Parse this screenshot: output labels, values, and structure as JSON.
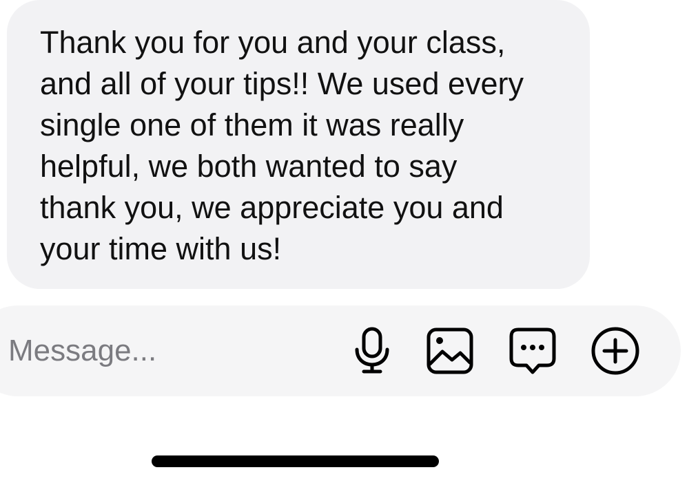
{
  "conversation": {
    "messages": [
      {
        "direction": "incoming",
        "text": "Thank you for you and your class,\nand all of your tips!! We used every\nsingle one of them it was really\nhelpful, we both wanted to say\nthank you, we appreciate you and\nyour time with us!"
      }
    ]
  },
  "composer": {
    "placeholder": "Message...",
    "value": "",
    "actions": [
      {
        "icon": "microphone-icon",
        "label": "Voice message"
      },
      {
        "icon": "image-icon",
        "label": "Photo"
      },
      {
        "icon": "sticker-message-icon",
        "label": "Sticker"
      },
      {
        "icon": "plus-circle-icon",
        "label": "More"
      }
    ]
  },
  "colors": {
    "bubble_background": "#f2f2f4",
    "composer_background": "#f5f5f6",
    "placeholder_text": "#7b7b80",
    "text": "#111111",
    "icon": "#000000"
  }
}
